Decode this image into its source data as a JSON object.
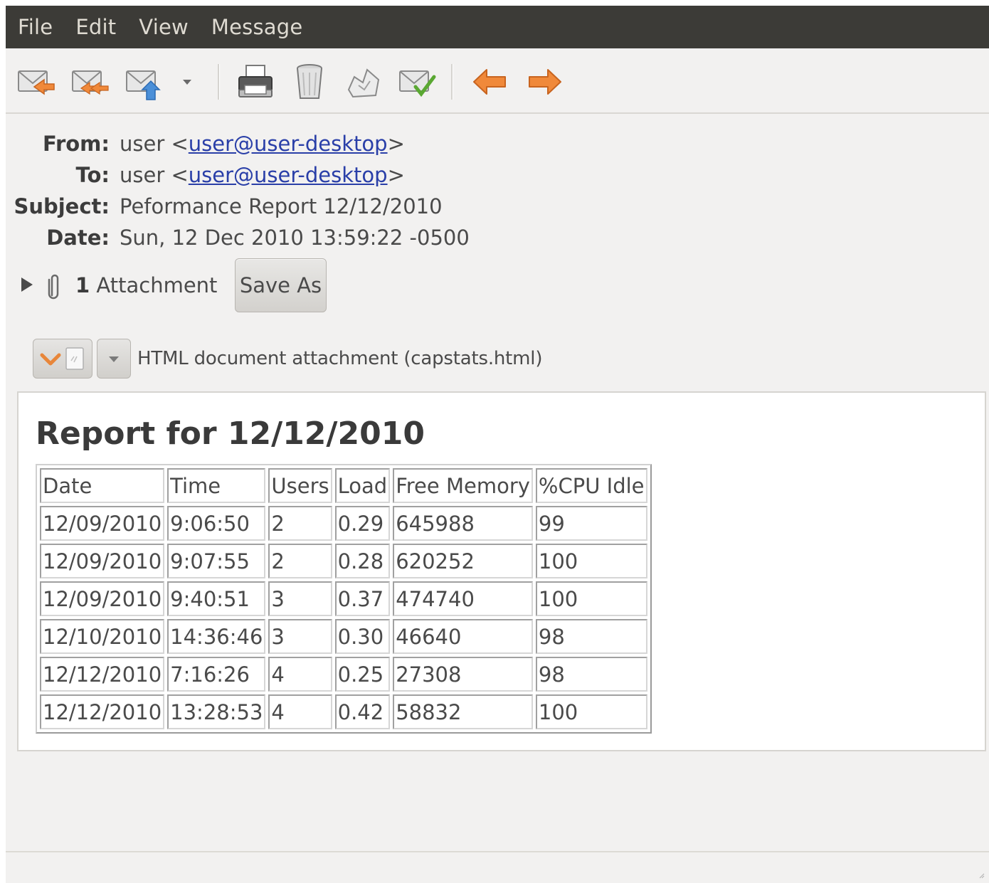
{
  "menubar": {
    "items": [
      "File",
      "Edit",
      "View",
      "Message"
    ]
  },
  "toolbar": {
    "buttons": [
      {
        "name": "reply-icon"
      },
      {
        "name": "reply-all-icon"
      },
      {
        "name": "forward-icon"
      },
      {
        "name": "forward-dropdown-icon"
      },
      {
        "name": "print-icon"
      },
      {
        "name": "delete-icon"
      },
      {
        "name": "junk-icon"
      },
      {
        "name": "not-junk-icon"
      },
      {
        "name": "previous-message-icon"
      },
      {
        "name": "next-message-icon"
      }
    ]
  },
  "headers": {
    "from": {
      "label": "From:",
      "name": "user <",
      "email": "user@user-desktop",
      "close": ">"
    },
    "to": {
      "label": "To:",
      "name": "user <",
      "email": "user@user-desktop",
      "close": ">"
    },
    "subject": {
      "label": "Subject:",
      "value": "Peformance Report 12/12/2010"
    },
    "date": {
      "label": "Date:",
      "value": "Sun, 12 Dec 2010 13:59:22 -0500"
    }
  },
  "attachments": {
    "count": "1",
    "label": "Attachment",
    "save_as": "Save As",
    "item_label": "HTML document attachment (capstats.html)"
  },
  "report": {
    "title": "Report for 12/12/2010",
    "columns": [
      "Date",
      "Time",
      "Users",
      "Load",
      "Free Memory",
      "%CPU Idle"
    ],
    "rows": [
      [
        "12/09/2010",
        "9:06:50",
        "2",
        "0.29",
        "645988",
        "99"
      ],
      [
        "12/09/2010",
        "9:07:55",
        "2",
        "0.28",
        "620252",
        "100"
      ],
      [
        "12/09/2010",
        "9:40:51",
        "3",
        "0.37",
        "474740",
        "100"
      ],
      [
        "12/10/2010",
        "14:36:46",
        "3",
        "0.30",
        "46640",
        "98"
      ],
      [
        "12/12/2010",
        "7:16:26",
        "4",
        "0.25",
        "27308",
        "98"
      ],
      [
        "12/12/2010",
        "13:28:53",
        "4",
        "0.42",
        "58832",
        "100"
      ]
    ]
  },
  "colors": {
    "menubar_bg": "#3c3b37",
    "link": "#2a3fa8",
    "arrow_orange": "#f0893a"
  }
}
